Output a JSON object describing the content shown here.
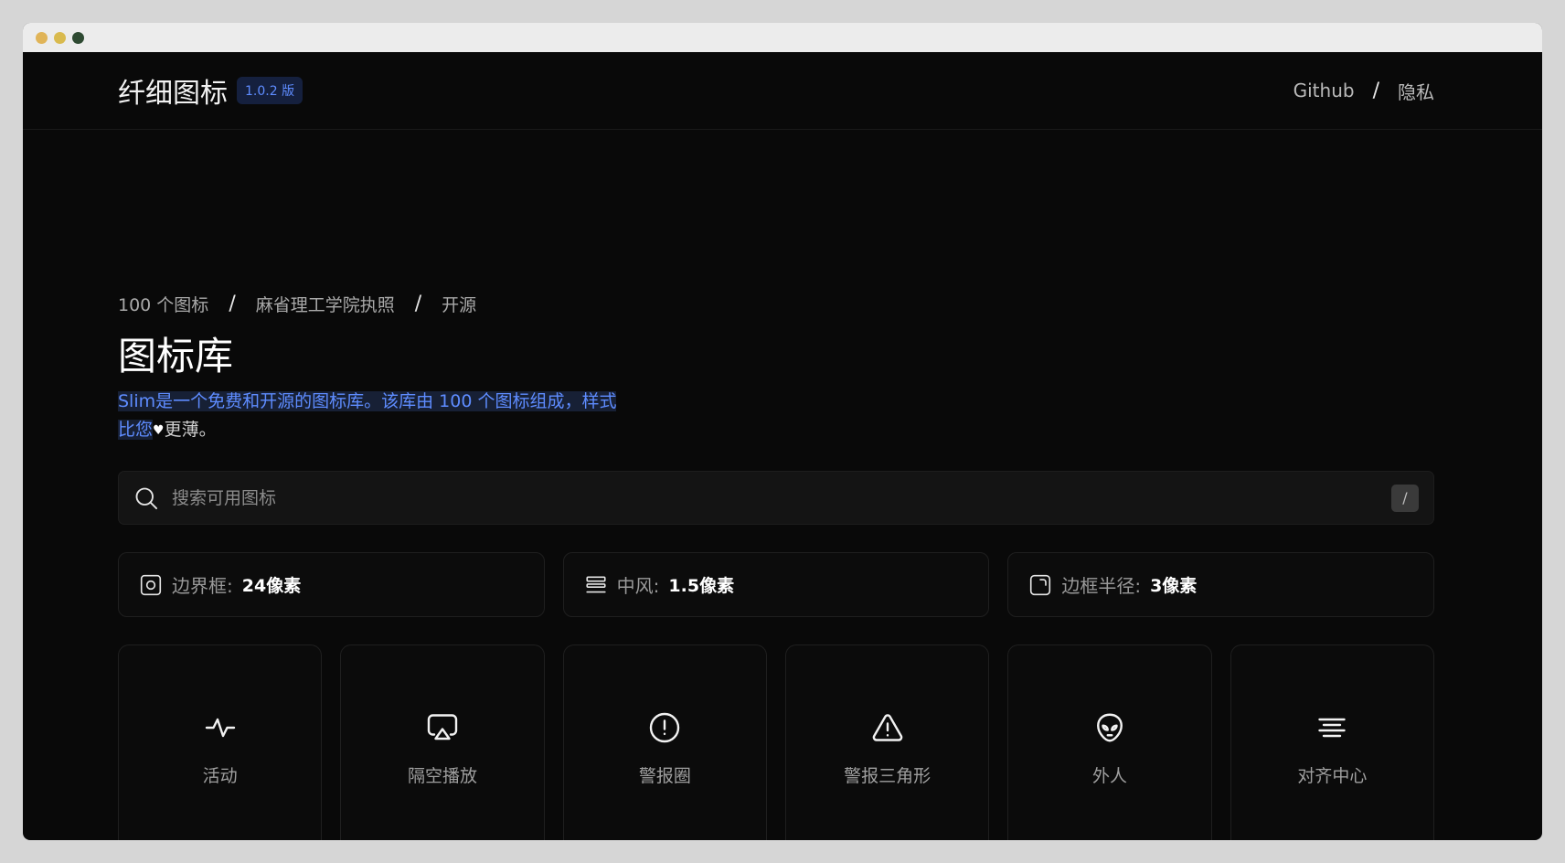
{
  "window": {
    "dots": [
      "#e0b458",
      "#d9ba4e",
      "#2e4a32"
    ]
  },
  "header": {
    "brand": "纤细图标",
    "version": "1.0.2 版",
    "nav": {
      "github": "Github",
      "separator": "/",
      "privacy": "隐私"
    }
  },
  "crumbs": {
    "items": [
      "100 个图标",
      "麻省理工学院执照",
      "开源"
    ],
    "separator": "/"
  },
  "title": "图标库",
  "intro": {
    "highlight": "Slim是一个免费和开源的图标库。该库由 100 个图标组成，样式比您",
    "rest": "更薄。"
  },
  "search": {
    "placeholder": "搜索可用图标",
    "shortcut": "/"
  },
  "settings": [
    {
      "icon": "bounding-box-icon",
      "label": "边界框:",
      "value": "24像素"
    },
    {
      "icon": "stroke-icon",
      "label": "中风:",
      "value": "1.5像素"
    },
    {
      "icon": "corner-radius-icon",
      "label": "边框半径:",
      "value": "3像素"
    }
  ],
  "icons": [
    {
      "icon": "activity-icon",
      "name": "活动"
    },
    {
      "icon": "airplay-icon",
      "name": "隔空播放"
    },
    {
      "icon": "alert-circle-icon",
      "name": "警报圈"
    },
    {
      "icon": "alert-triangle-icon",
      "name": "警报三角形"
    },
    {
      "icon": "alien-icon",
      "name": "外人"
    },
    {
      "icon": "align-center-icon",
      "name": "对齐中心"
    }
  ],
  "colors": {
    "accent": "#5e8cff",
    "background": "#090909",
    "highlight_bg": "#172035"
  }
}
